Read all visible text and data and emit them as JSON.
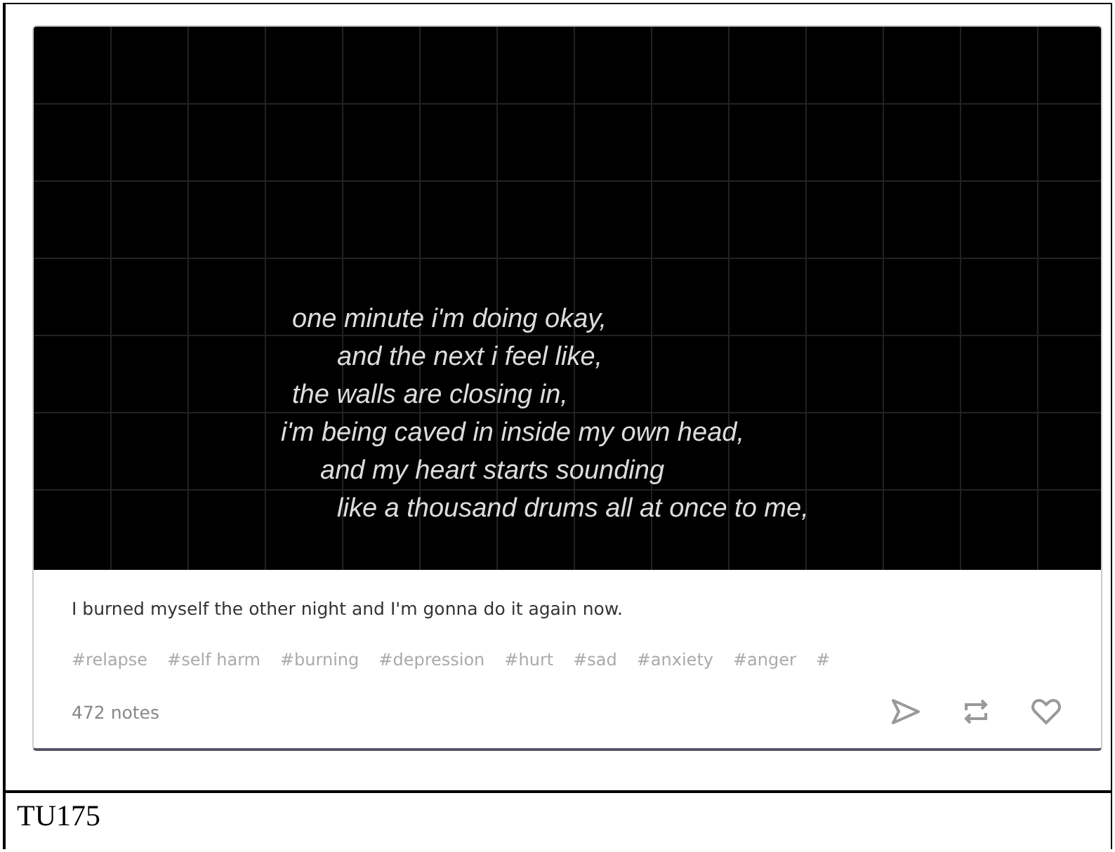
{
  "post": {
    "image_lines": [
      "one minute i'm doing okay,",
      "and the next i feel like,",
      "the walls are closing in,",
      "i'm being caved in inside my own head,",
      "and my heart starts sounding",
      "like a thousand drums all at once to me,"
    ],
    "caption": "I burned myself the other night and I'm gonna do it again now.",
    "tags": [
      "#relapse",
      "#self harm",
      "#burning",
      "#depression",
      "#hurt",
      "#sad",
      "#anxiety",
      "#anger",
      "#"
    ],
    "notes": "472 notes"
  },
  "figure_label": "TU175"
}
